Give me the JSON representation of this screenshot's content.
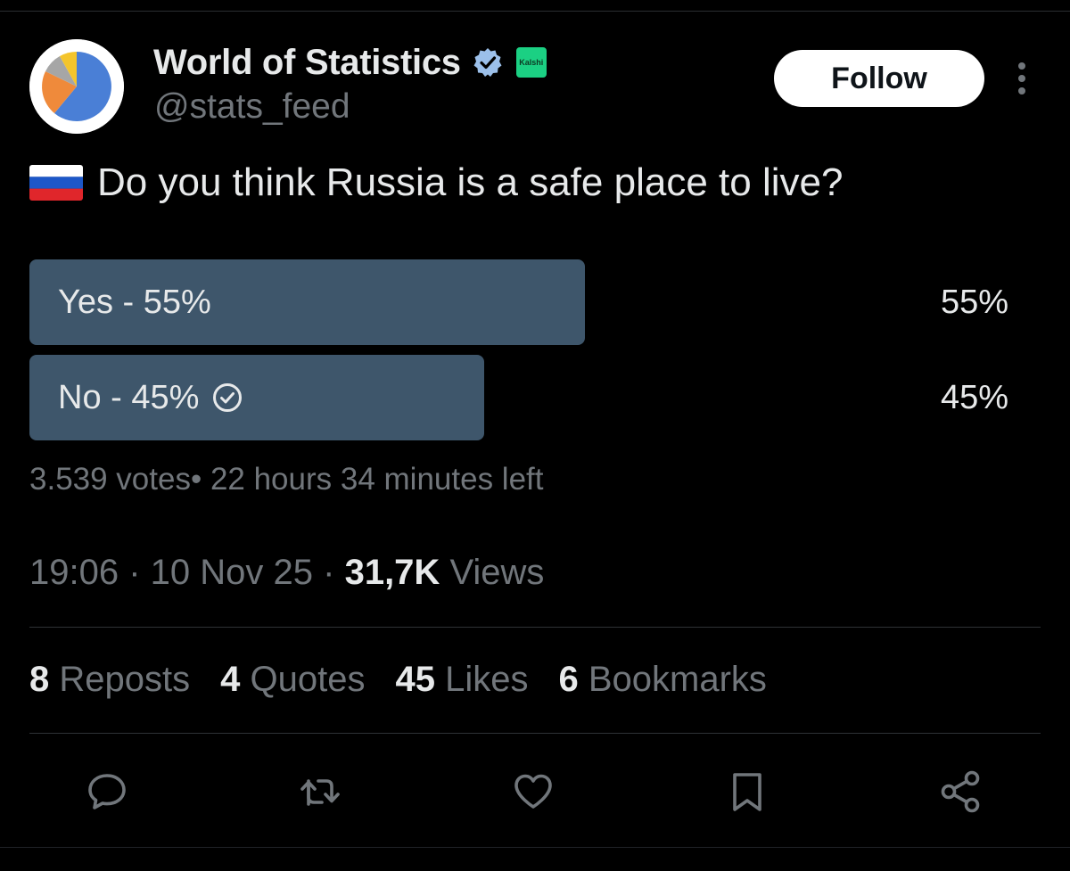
{
  "author": {
    "display_name": "World of Statistics",
    "handle": "@stats_feed",
    "affiliate_badge": "Kalshi",
    "avatar_icon": "pie-chart-avatar",
    "verified_icon": "verified-badge-icon"
  },
  "actions": {
    "follow_label": "Follow",
    "more_icon": "more-vertical-icon"
  },
  "post": {
    "flag_icon": "russia-flag-icon",
    "question": "Do you think Russia is a safe place to live?"
  },
  "poll": {
    "options": [
      {
        "label": "Yes - 55%",
        "percent_text": "55%",
        "share": 0.55,
        "selected": false
      },
      {
        "label": "No - 45%",
        "percent_text": "45%",
        "share": 0.45,
        "selected": true
      }
    ],
    "meta": "3.539 votes• 22 hours 34 minutes left",
    "bar_color": "#3e566b"
  },
  "timestamp": {
    "time": "19:06",
    "date": "10 Nov 25",
    "views_count": "31,7K",
    "views_label": "Views"
  },
  "stats": [
    {
      "count": "8",
      "label": "Reposts"
    },
    {
      "count": "4",
      "label": "Quotes"
    },
    {
      "count": "45",
      "label": "Likes"
    },
    {
      "count": "6",
      "label": "Bookmarks"
    }
  ],
  "action_bar": [
    "reply-icon",
    "repost-icon",
    "like-icon",
    "bookmark-icon",
    "share-icon"
  ],
  "colors": {
    "background": "#000000",
    "text_primary": "#e7e9ea",
    "text_secondary": "#71767b",
    "verified": "#1d9bf0",
    "affiliate": "#1bd083"
  }
}
